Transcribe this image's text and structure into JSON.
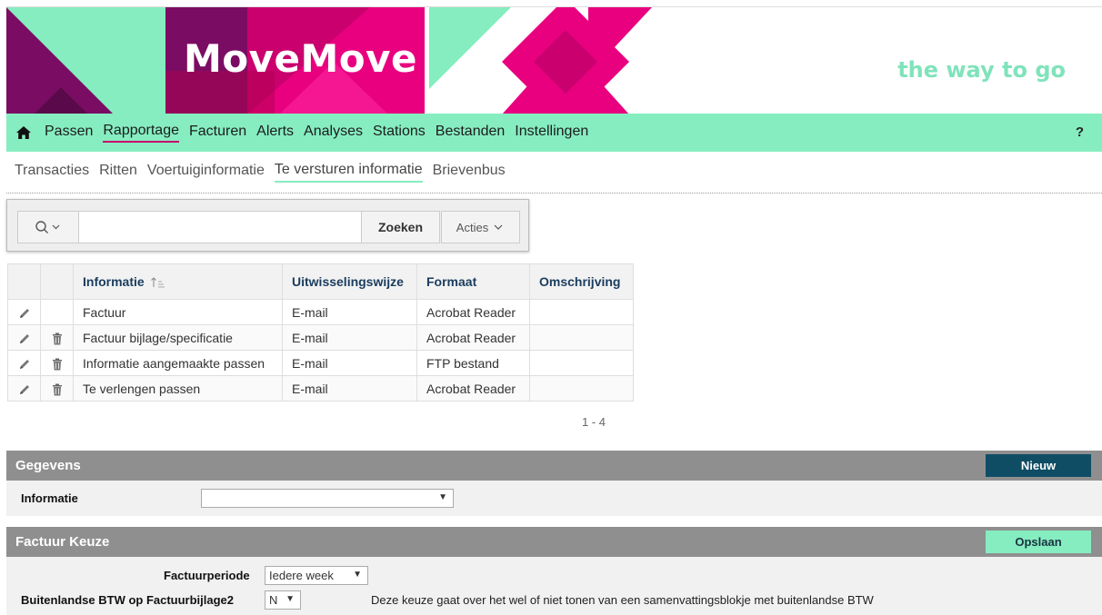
{
  "banner": {
    "brand": "MoveMove",
    "tagline": "the way to go"
  },
  "mainnav": {
    "items": [
      "Passen",
      "Rapportage",
      "Facturen",
      "Alerts",
      "Analyses",
      "Stations",
      "Bestanden",
      "Instellingen"
    ],
    "active": "Rapportage",
    "help": "?"
  },
  "subnav": {
    "items": [
      "Transacties",
      "Ritten",
      "Voertuiginformatie",
      "Te versturen informatie",
      "Brievenbus"
    ],
    "active": "Te versturen informatie"
  },
  "toolbar": {
    "search_value": "",
    "search_button": "Zoeken",
    "actions_label": "Acties"
  },
  "table": {
    "columns": [
      "Informatie",
      "Uitwisselingswijze",
      "Formaat",
      "Omschrijving"
    ],
    "rows": [
      {
        "informatie": "Factuur",
        "wijze": "E-mail",
        "formaat": "Acrobat Reader",
        "omschrijving": "",
        "deletable": false
      },
      {
        "informatie": "Factuur bijlage/specificatie",
        "wijze": "E-mail",
        "formaat": "Acrobat Reader",
        "omschrijving": "",
        "deletable": true
      },
      {
        "informatie": "Informatie aangemaakte passen",
        "wijze": "E-mail",
        "formaat": "FTP bestand",
        "omschrijving": "",
        "deletable": true
      },
      {
        "informatie": "Te verlengen passen",
        "wijze": "E-mail",
        "formaat": "Acrobat Reader",
        "omschrijving": "",
        "deletable": true
      }
    ],
    "pager": "1 - 4"
  },
  "gegevens": {
    "title": "Gegevens",
    "new_button": "Nieuw",
    "informatie_label": "Informatie",
    "informatie_value": ""
  },
  "factuur_keuze": {
    "title": "Factuur Keuze",
    "save_button": "Opslaan",
    "periode_label": "Factuurperiode",
    "periode_value": "Iedere week",
    "btw_label": "Buitenlandse BTW op Factuurbijlage2",
    "btw_value": "N",
    "btw_note": "Deze keuze gaat over het wel of niet tonen van een samenvattingsblokje met buitenlandse BTW"
  },
  "colors": {
    "mint": "#86edc0",
    "magenta": "#e8007f",
    "purple": "#7a0d63",
    "navy": "#0f4d65",
    "panel_grey": "#8f8f8f"
  }
}
